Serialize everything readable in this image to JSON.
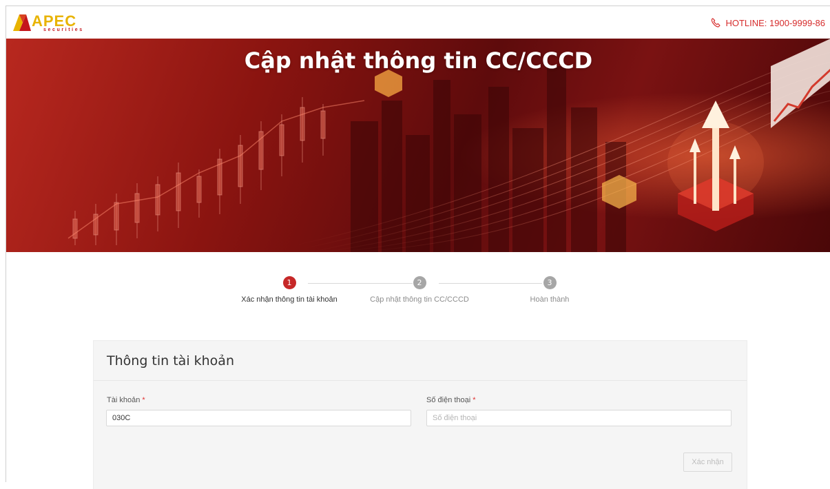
{
  "brand": {
    "name": "APEC",
    "tagline": "securities",
    "colors": {
      "gold": "#e8b300",
      "red": "#c4161c"
    }
  },
  "header": {
    "hotline_icon": "phone-icon",
    "hotline_text": "HOTLINE: 1900-9999-86"
  },
  "banner": {
    "title": "Cập nhật thông tin CC/CCCD"
  },
  "stepper": {
    "steps": [
      {
        "number": "1",
        "label": "Xác nhận thông tin tài khoản",
        "state": "active"
      },
      {
        "number": "2",
        "label": "Cập nhật thông tin CC/CCCD",
        "state": "pending"
      },
      {
        "number": "3",
        "label": "Hoàn thành",
        "state": "pending"
      }
    ],
    "colors": {
      "active": "#c62828",
      "pending": "#a6a6a6"
    }
  },
  "form": {
    "title": "Thông tin tài khoản",
    "account": {
      "label": "Tài khoản",
      "required_mark": "*",
      "value": "030C"
    },
    "phone": {
      "label": "Số điện thoại",
      "required_mark": "*",
      "value": "",
      "placeholder": "Số điện thoại"
    },
    "submit_label": "Xác nhận"
  }
}
